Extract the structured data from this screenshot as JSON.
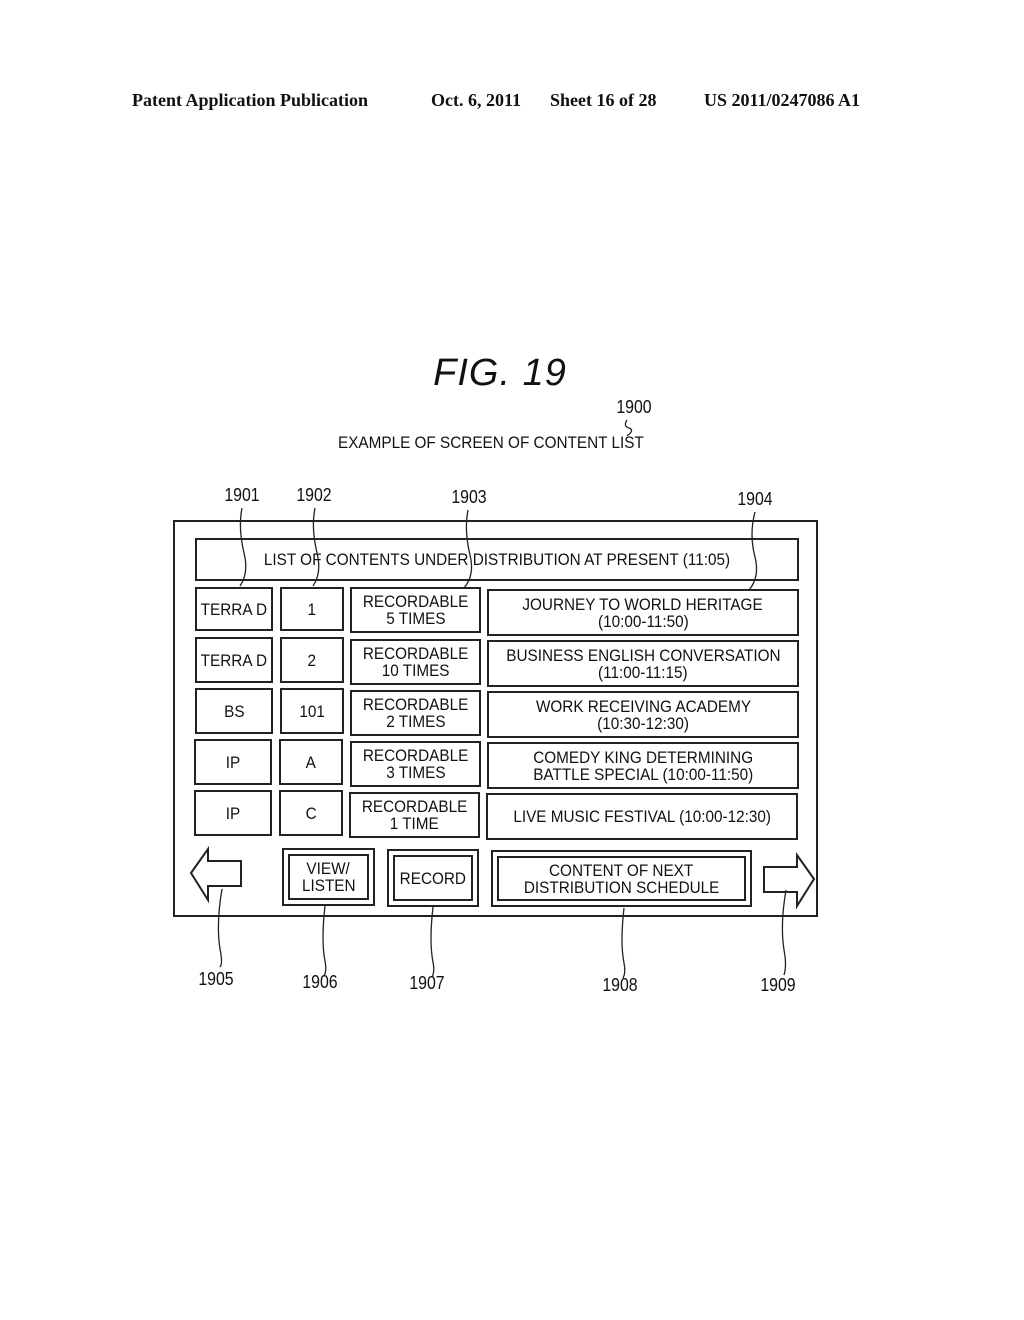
{
  "header": {
    "publication": "Patent Application Publication",
    "date": "Oct. 6, 2011",
    "sheet": "Sheet 16 of 28",
    "number": "US 2011/0247086 A1"
  },
  "figure": {
    "title": "FIG. 19",
    "ref": "1900",
    "caption": "EXAMPLE OF SCREEN OF CONTENT LIST"
  },
  "screen": {
    "heading": "LIST OF CONTENTS UNDER DISTRIBUTION AT PRESENT (11:05)",
    "rows": [
      {
        "network": "TERRA D",
        "channel": "1",
        "rec_line1": "RECORDABLE",
        "rec_line2": "5 TIMES",
        "title_line1": "JOURNEY TO WORLD HERITAGE",
        "title_line2": "(10:00-11:50)"
      },
      {
        "network": "TERRA D",
        "channel": "2",
        "rec_line1": "RECORDABLE",
        "rec_line2": "10 TIMES",
        "title_line1": "BUSINESS ENGLISH CONVERSATION",
        "title_line2": "(11:00-11:15)"
      },
      {
        "network": "BS",
        "channel": "101",
        "rec_line1": "RECORDABLE",
        "rec_line2": "2 TIMES",
        "title_line1": "WORK RECEIVING ACADEMY",
        "title_line2": "(10:30-12:30)"
      },
      {
        "network": "IP",
        "channel": "A",
        "rec_line1": "RECORDABLE",
        "rec_line2": "3 TIMES",
        "title_line1": "COMEDY KING DETERMINING",
        "title_line2": "BATTLE SPECIAL (10:00-11:50)"
      },
      {
        "network": "IP",
        "channel": "C",
        "rec_line1": "RECORDABLE",
        "rec_line2": "1 TIME",
        "title_line1": "LIVE MUSIC FESTIVAL (10:00-12:30)",
        "title_line2": ""
      }
    ],
    "buttons": {
      "view_line1": "VIEW/",
      "view_line2": "LISTEN",
      "record": "RECORD",
      "next_line1": "CONTENT OF NEXT",
      "next_line2": "DISTRIBUTION SCHEDULE"
    },
    "icons": {
      "prev": "left-arrow-icon",
      "next": "right-arrow-icon"
    }
  },
  "refs": {
    "r1901": "1901",
    "r1902": "1902",
    "r1903": "1903",
    "r1904": "1904",
    "r1905": "1905",
    "r1906": "1906",
    "r1907": "1907",
    "r1908": "1908",
    "r1909": "1909"
  }
}
